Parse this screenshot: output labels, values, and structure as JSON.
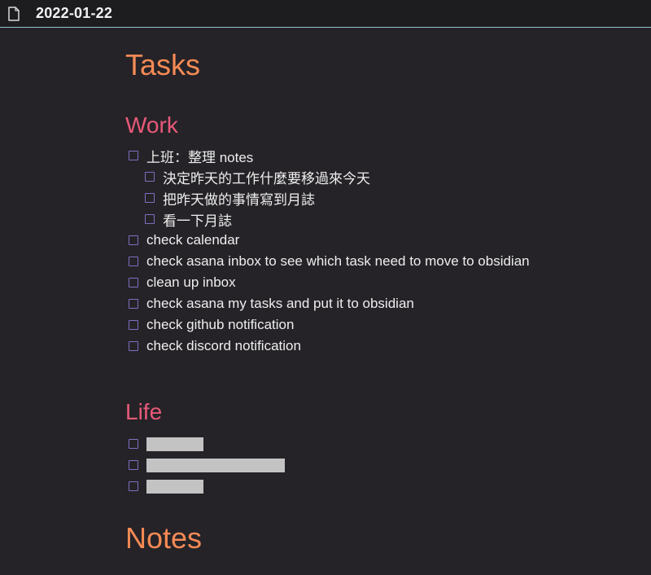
{
  "titlebar": {
    "icon": "file-icon",
    "title": "2022-01-22"
  },
  "colors": {
    "background": "#252327",
    "titlebar": "#1d1c1f",
    "accent_line": "#8fc8cc",
    "heading1": "#f58a55",
    "heading2": "#e8597a",
    "checkbox": "#7f6fc2",
    "text": "#eeeeee",
    "redaction": "#c3c3c3"
  },
  "sections": {
    "tasks_heading": "Tasks",
    "work_heading": "Work",
    "life_heading": "Life",
    "notes_heading": "Notes"
  },
  "work_tasks": [
    {
      "label": "上班：整理 notes",
      "checked": false
    },
    {
      "label": "決定昨天的工作什麼要移過來今天",
      "checked": false
    },
    {
      "label": "把昨天做的事情寫到月誌",
      "checked": false
    },
    {
      "label": "看一下月誌",
      "checked": false
    },
    {
      "label": "check calendar",
      "checked": false
    },
    {
      "label": "check asana inbox to see which task need to move to obsidian",
      "checked": false
    },
    {
      "label": "clean up inbox",
      "checked": false
    },
    {
      "label": "check asana my tasks and put it to obsidian",
      "checked": false
    },
    {
      "label": "check github notification",
      "checked": false
    },
    {
      "label": "check discord notification",
      "checked": false
    }
  ],
  "life_tasks": [
    {
      "label": "",
      "redacted": true,
      "checked": false
    },
    {
      "label": "",
      "redacted": true,
      "checked": false
    },
    {
      "label": "",
      "redacted": true,
      "checked": false
    }
  ]
}
